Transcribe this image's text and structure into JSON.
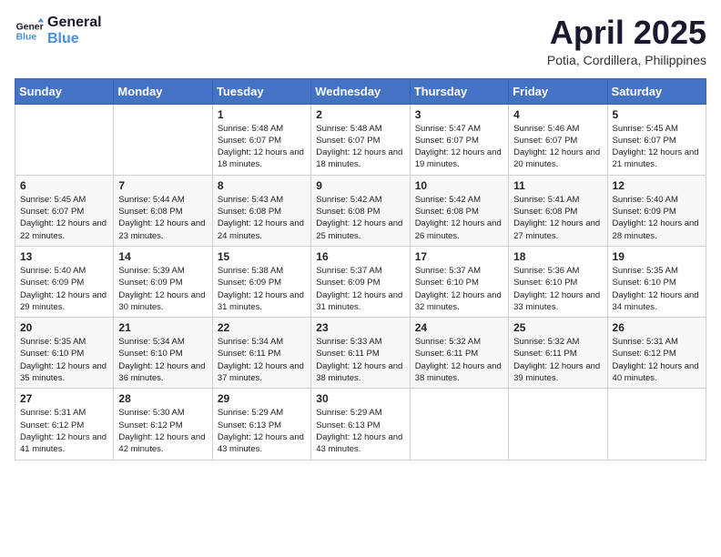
{
  "header": {
    "logo_line1": "General",
    "logo_line2": "Blue",
    "month_title": "April 2025",
    "location": "Potia, Cordillera, Philippines"
  },
  "days_of_week": [
    "Sunday",
    "Monday",
    "Tuesday",
    "Wednesday",
    "Thursday",
    "Friday",
    "Saturday"
  ],
  "weeks": [
    [
      {
        "day": "",
        "info": ""
      },
      {
        "day": "",
        "info": ""
      },
      {
        "day": "1",
        "info": "Sunrise: 5:48 AM\nSunset: 6:07 PM\nDaylight: 12 hours and 18 minutes."
      },
      {
        "day": "2",
        "info": "Sunrise: 5:48 AM\nSunset: 6:07 PM\nDaylight: 12 hours and 18 minutes."
      },
      {
        "day": "3",
        "info": "Sunrise: 5:47 AM\nSunset: 6:07 PM\nDaylight: 12 hours and 19 minutes."
      },
      {
        "day": "4",
        "info": "Sunrise: 5:46 AM\nSunset: 6:07 PM\nDaylight: 12 hours and 20 minutes."
      },
      {
        "day": "5",
        "info": "Sunrise: 5:45 AM\nSunset: 6:07 PM\nDaylight: 12 hours and 21 minutes."
      }
    ],
    [
      {
        "day": "6",
        "info": "Sunrise: 5:45 AM\nSunset: 6:07 PM\nDaylight: 12 hours and 22 minutes."
      },
      {
        "day": "7",
        "info": "Sunrise: 5:44 AM\nSunset: 6:08 PM\nDaylight: 12 hours and 23 minutes."
      },
      {
        "day": "8",
        "info": "Sunrise: 5:43 AM\nSunset: 6:08 PM\nDaylight: 12 hours and 24 minutes."
      },
      {
        "day": "9",
        "info": "Sunrise: 5:42 AM\nSunset: 6:08 PM\nDaylight: 12 hours and 25 minutes."
      },
      {
        "day": "10",
        "info": "Sunrise: 5:42 AM\nSunset: 6:08 PM\nDaylight: 12 hours and 26 minutes."
      },
      {
        "day": "11",
        "info": "Sunrise: 5:41 AM\nSunset: 6:08 PM\nDaylight: 12 hours and 27 minutes."
      },
      {
        "day": "12",
        "info": "Sunrise: 5:40 AM\nSunset: 6:09 PM\nDaylight: 12 hours and 28 minutes."
      }
    ],
    [
      {
        "day": "13",
        "info": "Sunrise: 5:40 AM\nSunset: 6:09 PM\nDaylight: 12 hours and 29 minutes."
      },
      {
        "day": "14",
        "info": "Sunrise: 5:39 AM\nSunset: 6:09 PM\nDaylight: 12 hours and 30 minutes."
      },
      {
        "day": "15",
        "info": "Sunrise: 5:38 AM\nSunset: 6:09 PM\nDaylight: 12 hours and 31 minutes."
      },
      {
        "day": "16",
        "info": "Sunrise: 5:37 AM\nSunset: 6:09 PM\nDaylight: 12 hours and 31 minutes."
      },
      {
        "day": "17",
        "info": "Sunrise: 5:37 AM\nSunset: 6:10 PM\nDaylight: 12 hours and 32 minutes."
      },
      {
        "day": "18",
        "info": "Sunrise: 5:36 AM\nSunset: 6:10 PM\nDaylight: 12 hours and 33 minutes."
      },
      {
        "day": "19",
        "info": "Sunrise: 5:35 AM\nSunset: 6:10 PM\nDaylight: 12 hours and 34 minutes."
      }
    ],
    [
      {
        "day": "20",
        "info": "Sunrise: 5:35 AM\nSunset: 6:10 PM\nDaylight: 12 hours and 35 minutes."
      },
      {
        "day": "21",
        "info": "Sunrise: 5:34 AM\nSunset: 6:10 PM\nDaylight: 12 hours and 36 minutes."
      },
      {
        "day": "22",
        "info": "Sunrise: 5:34 AM\nSunset: 6:11 PM\nDaylight: 12 hours and 37 minutes."
      },
      {
        "day": "23",
        "info": "Sunrise: 5:33 AM\nSunset: 6:11 PM\nDaylight: 12 hours and 38 minutes."
      },
      {
        "day": "24",
        "info": "Sunrise: 5:32 AM\nSunset: 6:11 PM\nDaylight: 12 hours and 38 minutes."
      },
      {
        "day": "25",
        "info": "Sunrise: 5:32 AM\nSunset: 6:11 PM\nDaylight: 12 hours and 39 minutes."
      },
      {
        "day": "26",
        "info": "Sunrise: 5:31 AM\nSunset: 6:12 PM\nDaylight: 12 hours and 40 minutes."
      }
    ],
    [
      {
        "day": "27",
        "info": "Sunrise: 5:31 AM\nSunset: 6:12 PM\nDaylight: 12 hours and 41 minutes."
      },
      {
        "day": "28",
        "info": "Sunrise: 5:30 AM\nSunset: 6:12 PM\nDaylight: 12 hours and 42 minutes."
      },
      {
        "day": "29",
        "info": "Sunrise: 5:29 AM\nSunset: 6:13 PM\nDaylight: 12 hours and 43 minutes."
      },
      {
        "day": "30",
        "info": "Sunrise: 5:29 AM\nSunset: 6:13 PM\nDaylight: 12 hours and 43 minutes."
      },
      {
        "day": "",
        "info": ""
      },
      {
        "day": "",
        "info": ""
      },
      {
        "day": "",
        "info": ""
      }
    ]
  ]
}
